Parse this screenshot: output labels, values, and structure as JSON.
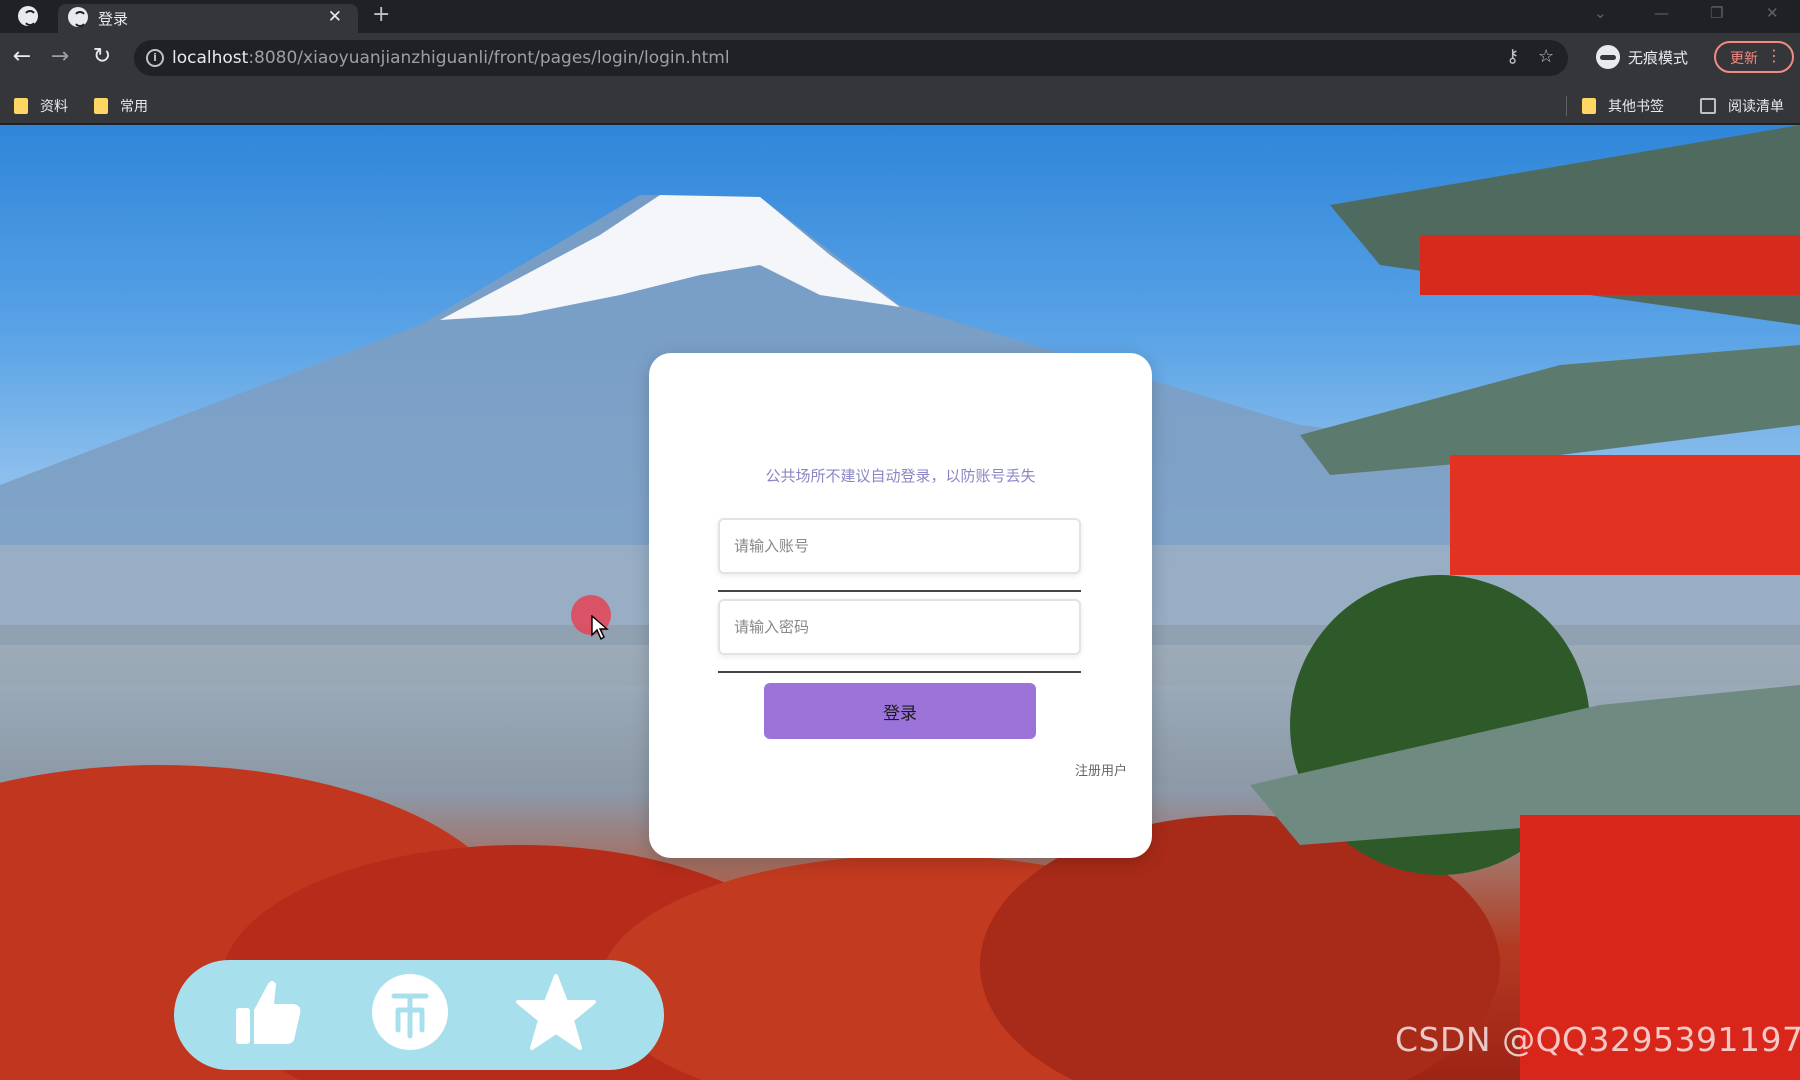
{
  "browser": {
    "tab_title": "登录",
    "url_host": "localhost",
    "url_rest": ":8080/xiaoyuanjianzhiguanli/front/pages/login/login.html",
    "incognito_label": "无痕模式",
    "update_label": "更新",
    "bookmarks": [
      "资料",
      "常用"
    ],
    "other_bookmarks": "其他书签",
    "reading_list": "阅读清单"
  },
  "login": {
    "tip": "公共场所不建议自动登录，以防账号丢失",
    "username_placeholder": "请输入账号",
    "password_placeholder": "请输入密码",
    "login_label": "登录",
    "register_label": "注册用户"
  },
  "overlay": {
    "action_icons": [
      "thumbs-up-icon",
      "coin-icon",
      "star-icon"
    ],
    "watermark": "CSDN @QQ3295391197"
  },
  "colors": {
    "login_button": "#9b73d9",
    "tip_text": "#8a86c6",
    "action_bar": "#a8dfec"
  }
}
